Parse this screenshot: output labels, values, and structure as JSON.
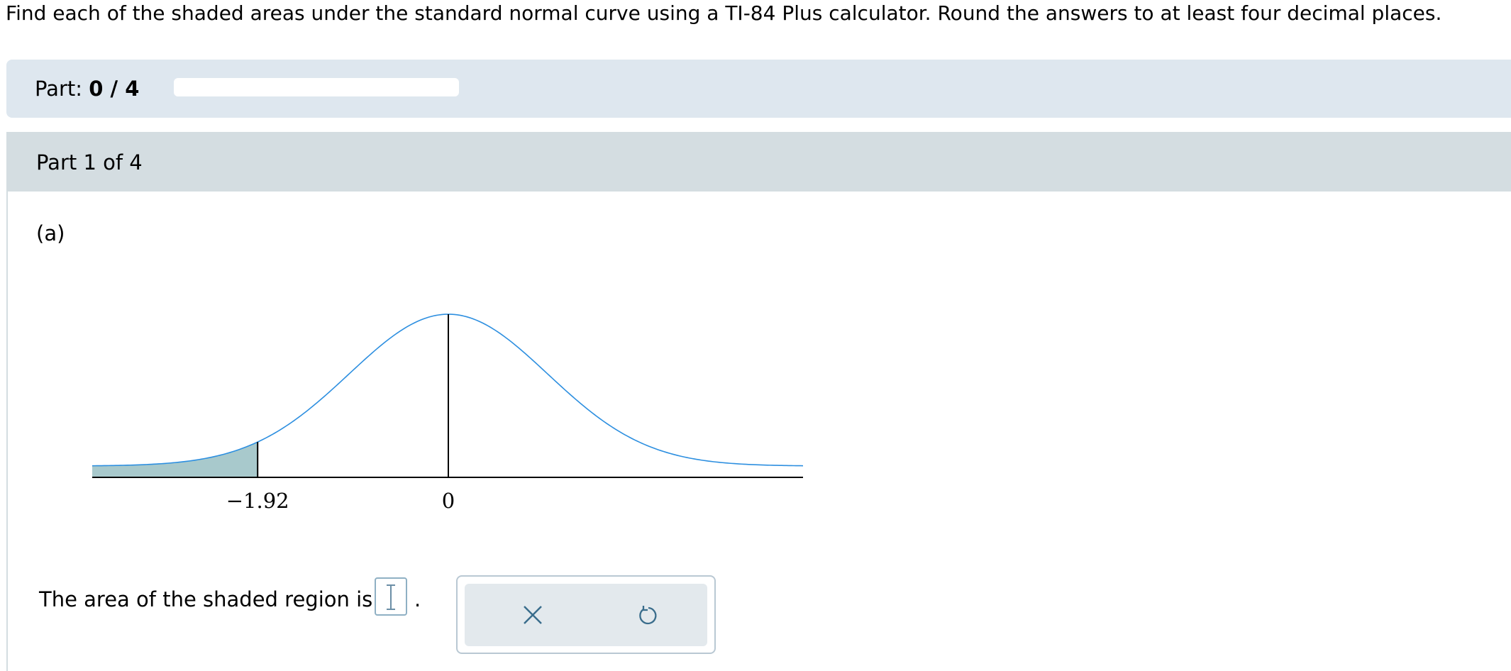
{
  "instructions": "Find each of the shaded areas under the standard normal curve using a TI-84 Plus calculator. Round the answers to at least four decimal places.",
  "progress": {
    "label": "Part:",
    "value": "0 / 4",
    "fraction": 0
  },
  "part": {
    "title": "Part 1 of 4",
    "sub_label": "(a)"
  },
  "figure": {
    "tick_labels": [
      "−1.92",
      "0"
    ],
    "shaded_region": "left tail",
    "z_cutoff": -1.92,
    "colors": {
      "curve": "#2d8fe0",
      "shade": "#a8c9cc",
      "axis": "#000000"
    }
  },
  "answer": {
    "prompt": "The area of the shaded region is",
    "value": "",
    "suffix": "."
  },
  "actions": {
    "clear_icon": "close-icon",
    "undo_icon": "undo-icon"
  }
}
